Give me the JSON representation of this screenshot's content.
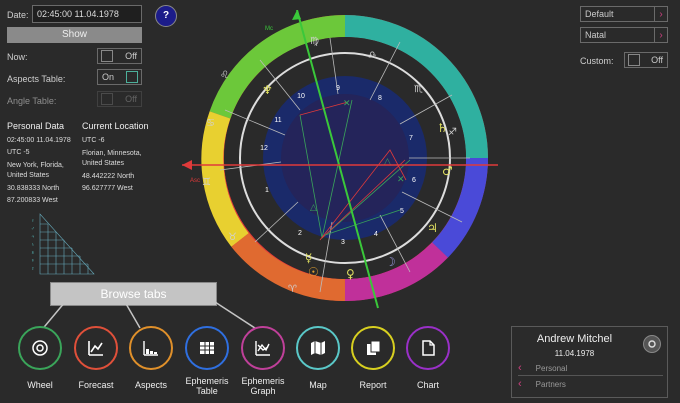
{
  "left": {
    "date_label": "Date:",
    "date_value": "02:45:00 11.04.1978",
    "show_button": "Show",
    "now_label": "Now:",
    "now_state": "Off",
    "aspects_label": "Aspects Table:",
    "aspects_state": "On",
    "angle_label": "Angle Table:",
    "angle_state": "Off"
  },
  "personal": {
    "title": "Personal Data",
    "time": "02:45:00 11.04.1978",
    "utc": "UTC -5",
    "place": "New York, Florida, United States",
    "lat": "30.838333 North",
    "lon": "87.200833 West"
  },
  "location": {
    "title": "Current Location",
    "utc": "UTC -6",
    "place": "Florian, Minnesota, United States",
    "lat": "48.442222 North",
    "lon": "96.627777 West"
  },
  "help_icon": "?",
  "right": {
    "preset": "Default",
    "chart_kind": "Natal",
    "custom_label": "Custom:",
    "custom_state": "Off"
  },
  "wheel": {
    "houses": [
      "1",
      "2",
      "3",
      "4",
      "5",
      "6",
      "7",
      "8",
      "9",
      "10",
      "11",
      "12"
    ],
    "mc_label": "Mc",
    "asc_label": "Asc"
  },
  "tooltip": "Browse tabs",
  "nav": [
    {
      "label": "Wheel",
      "color": "#3aa55a"
    },
    {
      "label": "Forecast",
      "color": "#e0503a"
    },
    {
      "label": "Aspects",
      "color": "#e0902a"
    },
    {
      "label": "Ephemeris Table",
      "color": "#2f6fe0"
    },
    {
      "label": "Ephemeris Graph",
      "color": "#c0409a"
    },
    {
      "label": "Map",
      "color": "#5ac8c8"
    },
    {
      "label": "Report",
      "color": "#d8d020"
    },
    {
      "label": "Chart",
      "color": "#9a30c8"
    }
  ],
  "profile": {
    "name": "Andrew Mitchel",
    "date": "11.04.1978",
    "personal": "Personal",
    "partners": "Partners",
    "settings_icon": "gear-icon"
  }
}
